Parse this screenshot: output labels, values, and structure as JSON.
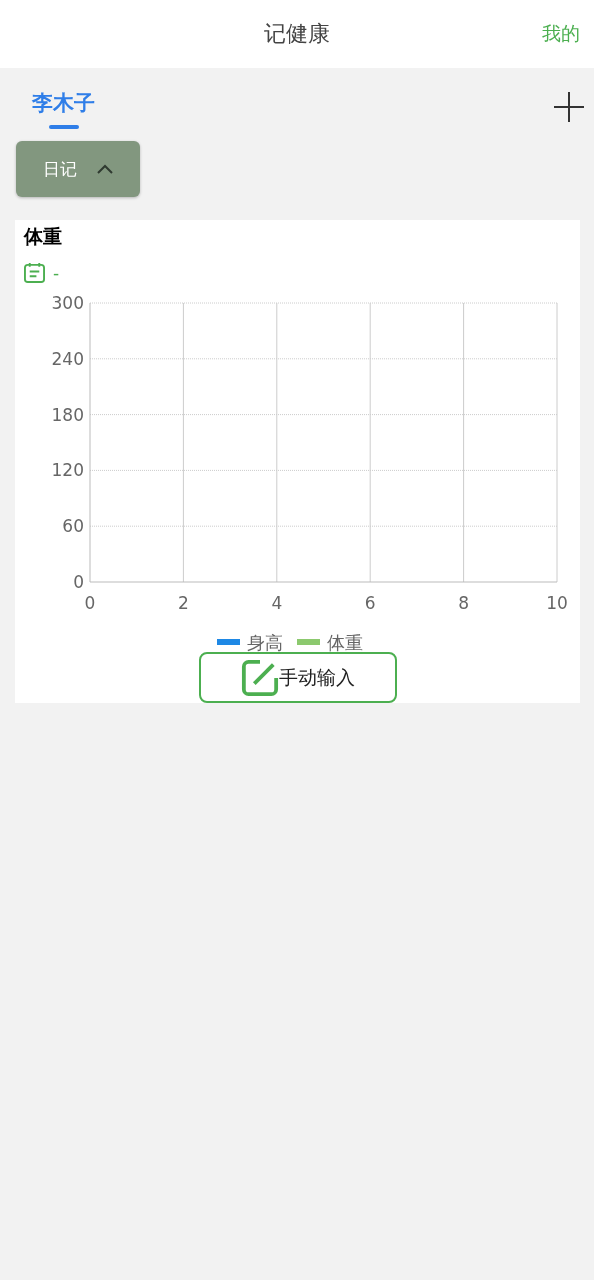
{
  "header": {
    "title": "记健康",
    "action": "我的"
  },
  "tabs": [
    {
      "label": "李木子",
      "selected": true
    }
  ],
  "dropdown": {
    "label": "日记",
    "expanded": true
  },
  "card": {
    "title": "体重",
    "date": "-",
    "button": "手动输入",
    "chart_data": {
      "type": "line",
      "categories": [
        "0",
        "2",
        "4",
        "6",
        "8",
        "10"
      ],
      "ylim": [
        0,
        300
      ],
      "yticks": [
        0,
        60,
        120,
        180,
        240,
        300
      ],
      "grid": true,
      "series": [
        {
          "name": "身高",
          "color": "#1e88e5",
          "values": [
            null,
            null,
            null,
            null,
            null,
            null
          ]
        },
        {
          "name": "体重",
          "color": "#8cc96e",
          "values": [
            null,
            null,
            null,
            null,
            null,
            null
          ]
        }
      ]
    }
  }
}
